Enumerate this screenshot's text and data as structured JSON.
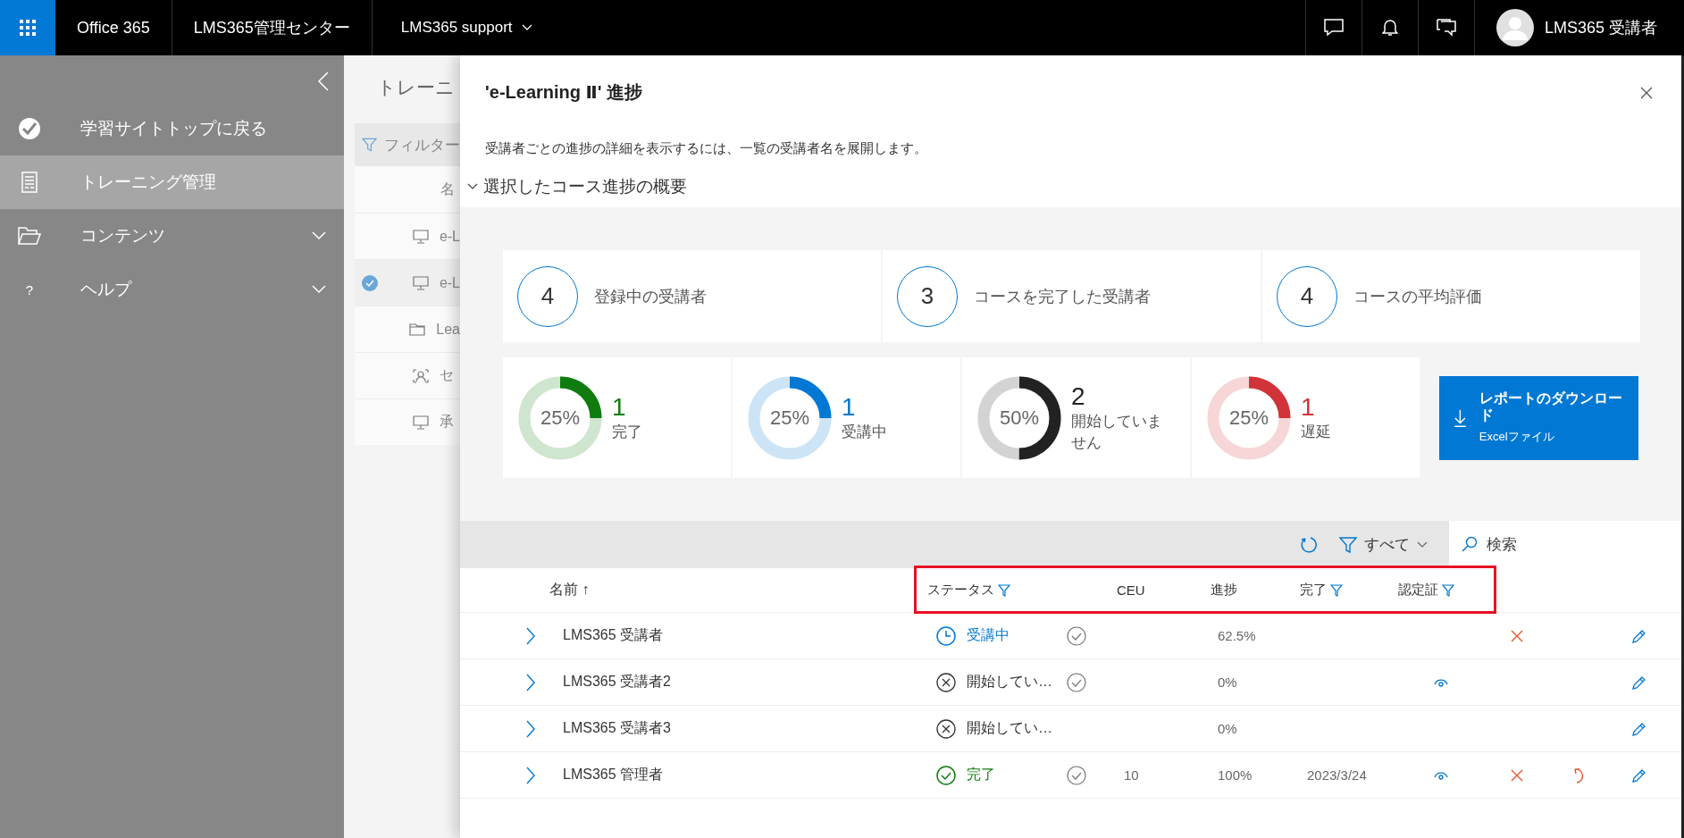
{
  "topbar": {
    "app": "Office 365",
    "center": "LMS365管理センター",
    "site": "LMS365 support",
    "user": "LMS365 受講者"
  },
  "sidebar": {
    "items": [
      {
        "kind": "check",
        "label": "学習サイトトップに戻る",
        "selected": false,
        "expandable": false
      },
      {
        "kind": "doc",
        "label": "トレーニング管理",
        "selected": true,
        "expandable": false
      },
      {
        "kind": "folder",
        "label": "コンテンツ",
        "selected": false,
        "expandable": true
      },
      {
        "kind": "help",
        "icon_text": "?",
        "label": "ヘルプ",
        "selected": false,
        "expandable": true
      }
    ]
  },
  "background": {
    "title": "トレーニ",
    "filter": "フィルター",
    "column": "名",
    "rows": [
      {
        "kind": "monitor",
        "label": "e-L",
        "selected": false
      },
      {
        "kind": "monitor",
        "label": "e-L",
        "selected": true
      },
      {
        "kind": "folder",
        "label": "Lea",
        "selected": false
      },
      {
        "kind": "person",
        "label": "セ",
        "selected": false
      },
      {
        "kind": "monitor",
        "label": "承",
        "selected": false
      }
    ]
  },
  "panel": {
    "title": "'e-Learning Ⅱ' 進捗",
    "description": "受講者ごとの進捗の詳細を表示するには、一覧の受講者名を展開します。",
    "section": "選択したコース進捗の概要",
    "section_expanded": true,
    "summary": [
      {
        "value": "4",
        "label": "登録中の受講者"
      },
      {
        "value": "3",
        "label": "コースを完了した受講者"
      },
      {
        "value": "4",
        "label": "コースの平均評価"
      }
    ],
    "donuts": [
      {
        "percent": "25%",
        "level": 0.25,
        "color": "#107c10",
        "value": "1",
        "label": "完了"
      },
      {
        "percent": "25%",
        "level": 0.25,
        "color": "#0078d4",
        "value": "1",
        "label": "受講中"
      },
      {
        "percent": "50%",
        "level": 0.5,
        "color": "#222222",
        "value": "2",
        "label": "開始していません"
      },
      {
        "percent": "25%",
        "level": 0.25,
        "color": "#d13438",
        "value": "1",
        "label": "遅延"
      }
    ],
    "download": {
      "title": "レポートのダウンロード",
      "subtitle": "Excelファイル"
    },
    "toolbar": {
      "filter": "すべて",
      "search_placeholder": "検索"
    },
    "columns": [
      "名前 ↑",
      "ステータス",
      "CEU",
      "進捗",
      "完了",
      "認定証"
    ],
    "rows": [
      {
        "name": "LMS365 受講者",
        "status": {
          "kind": "in_progress",
          "label": "受講中"
        },
        "checkmark": true,
        "ceu": "",
        "progress": "62.5%",
        "completed": "",
        "certificate": false,
        "remove": true,
        "redo": false
      },
      {
        "name": "LMS365 受講者2",
        "status": {
          "kind": "not_started",
          "label": "開始してい…"
        },
        "checkmark": true,
        "ceu": "",
        "progress": "0%",
        "completed": "",
        "certificate": true,
        "remove": false,
        "redo": false
      },
      {
        "name": "LMS365 受講者3",
        "status": {
          "kind": "not_started",
          "label": "開始してい…"
        },
        "checkmark": false,
        "ceu": "",
        "progress": "0%",
        "completed": "",
        "certificate": false,
        "remove": false,
        "redo": false
      },
      {
        "name": "LMS365 管理者",
        "status": {
          "kind": "completed",
          "label": "完了"
        },
        "checkmark": true,
        "ceu": "10",
        "progress": "100%",
        "completed": "2023/3/24",
        "certificate": true,
        "remove": true,
        "redo": true
      }
    ]
  }
}
